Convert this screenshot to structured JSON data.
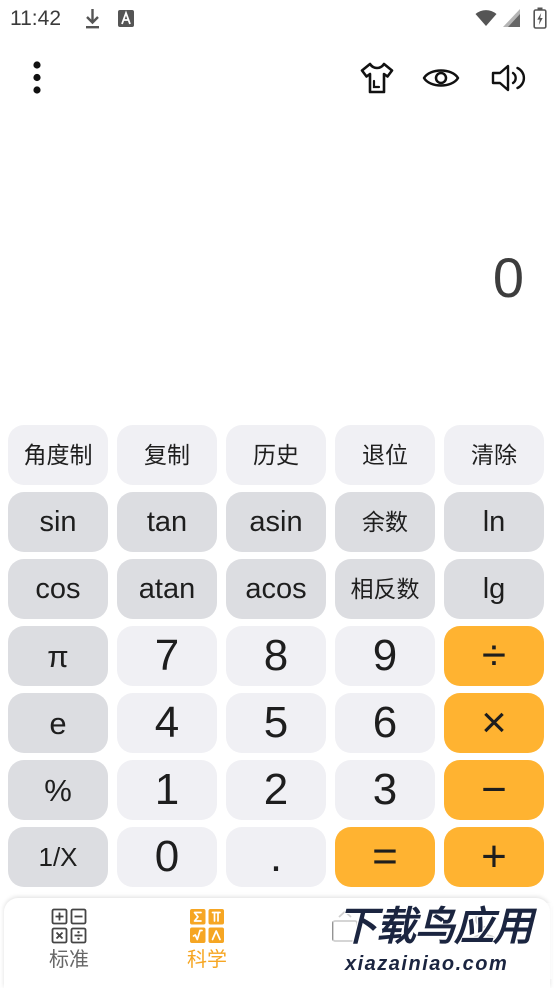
{
  "status_bar": {
    "time": "11:42",
    "left_icons": [
      "download-icon",
      "a-notification-icon"
    ],
    "right_icons": [
      "wifi-icon",
      "cellular-signal-icon",
      "battery-charging-icon"
    ]
  },
  "toolbar": {
    "icons": [
      "more-vertical-icon",
      "shirt-icon",
      "eye-icon",
      "speaker-icon"
    ]
  },
  "display": {
    "value": "0"
  },
  "keypad": {
    "rows": [
      [
        "角度制",
        "复制",
        "历史",
        "退位",
        "清除"
      ],
      [
        "sin",
        "tan",
        "asin",
        "余数",
        "ln"
      ],
      [
        "cos",
        "atan",
        "acos",
        "相反数",
        "lg"
      ],
      [
        "π",
        "7",
        "8",
        "9",
        "÷"
      ],
      [
        "e",
        "4",
        "5",
        "6",
        "×"
      ],
      [
        "%",
        "1",
        "2",
        "3",
        "−"
      ],
      [
        "1/X",
        "0",
        ".",
        "=",
        "+"
      ]
    ]
  },
  "bottom_nav": {
    "items": [
      {
        "label": "标准",
        "icon": "standard-calculator-icon",
        "selected": false
      },
      {
        "label": "科学",
        "icon": "scientific-calculator-icon",
        "selected": true
      },
      {
        "icon": "third-tab-icon"
      },
      {
        "icon": "fourth-tab-icon"
      }
    ]
  },
  "watermark": {
    "title": "下载鸟应用",
    "url": "xiazainiao.com"
  },
  "colors": {
    "background": "#ffffff",
    "key_light": "#f0f0f4",
    "key_dark": "#dcdde1",
    "key_orange": "#ffb331",
    "accent": "#f6a623",
    "text": "#1e1e1e"
  }
}
